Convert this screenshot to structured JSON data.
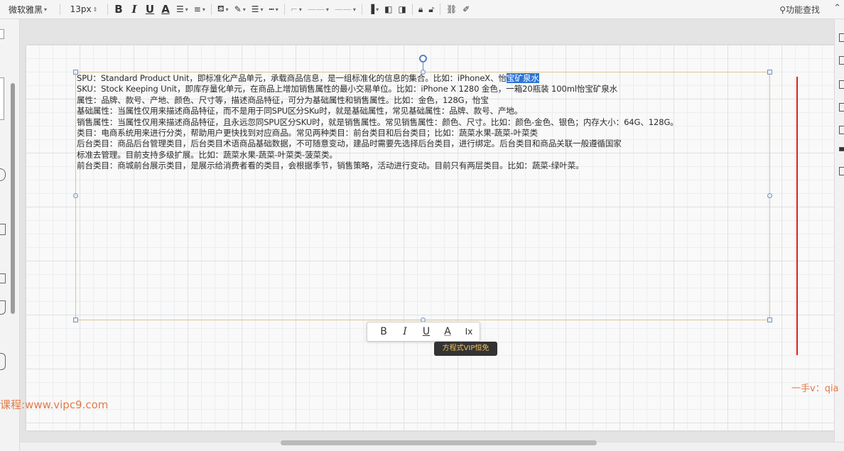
{
  "toolbar": {
    "font_family": "微软雅黑",
    "font_size": "13px",
    "bold": "B",
    "italic": "I",
    "underline": "U",
    "font_color": "A",
    "search_label": "功能查找",
    "caret": "▾"
  },
  "document": {
    "lines": [
      {
        "text": "SPU：Standard Product Unit，即标准化产品单元，承载商品信息，是一组标准化的信息的集合。比如：iPhoneX、怡",
        "selected": "宝矿泉水"
      },
      {
        "text": "SKU：Stock Keeping Unit，即库存量化单元，在商品上增加销售属性的最小交易单位。比如：iPhone X 1280 金色，一箱20瓶装 100ml怡宝矿泉水"
      },
      {
        "text": "属性：品牌、款号、产地、颜色、尺寸等，描述商品特征，可分为基础属性和销售属性。比如：金色，128G，怡宝"
      },
      {
        "text": "基础属性：当属性仅用来描述商品特征，而不是用于同SPU区分SKu时，就是基础属性，常见基础属性：品牌、款号、产地。"
      },
      {
        "text": "销售属性：当属性仅用来描述商品特征，且永远忽同SPU区分SKU时，就是销售属性。常见销售属性：颜色、尺寸。比如：颜色-金色、银色；内存大小：64G、128G。"
      },
      {
        "text": "类目：电商系统用来进行分类，帮助用户更快找到对应商品。常见两种类目：前台类目和后台类目；比如：蔬菜水果-蔬菜-叶菜类"
      },
      {
        "text": "后台类目：商品后台管理类目，后台类目术语商品基础数据，不可随意变动，建品时需要先选择后台类目，进行绑定。后台类目和商品关联一般遵循国家"
      },
      {
        "text": "标准去管理。目前支持多级扩展。比如：蔬菜水果-蔬菜-叶菜类-菠菜类。"
      },
      {
        "text": "前台类目：商城前台展示类目，是展示给消费者看的类目，会根据季节，销售策略，活动进行变动。目前只有两层类目。比如：蔬菜-绿叶菜。"
      }
    ]
  },
  "mini_toolbar": {
    "bold": "B",
    "italic": "I",
    "underline": "U",
    "color": "A",
    "clear": "Ix"
  },
  "tooltip": "方程式VIP恒免",
  "watermarks": {
    "left": "课程:www.vipc9.com",
    "right": "一手v：qia"
  },
  "colors": {
    "selection": "#2b74d8",
    "frame": "#d8c596",
    "guide_line": "#e02020",
    "watermark": "#e37b4a"
  }
}
